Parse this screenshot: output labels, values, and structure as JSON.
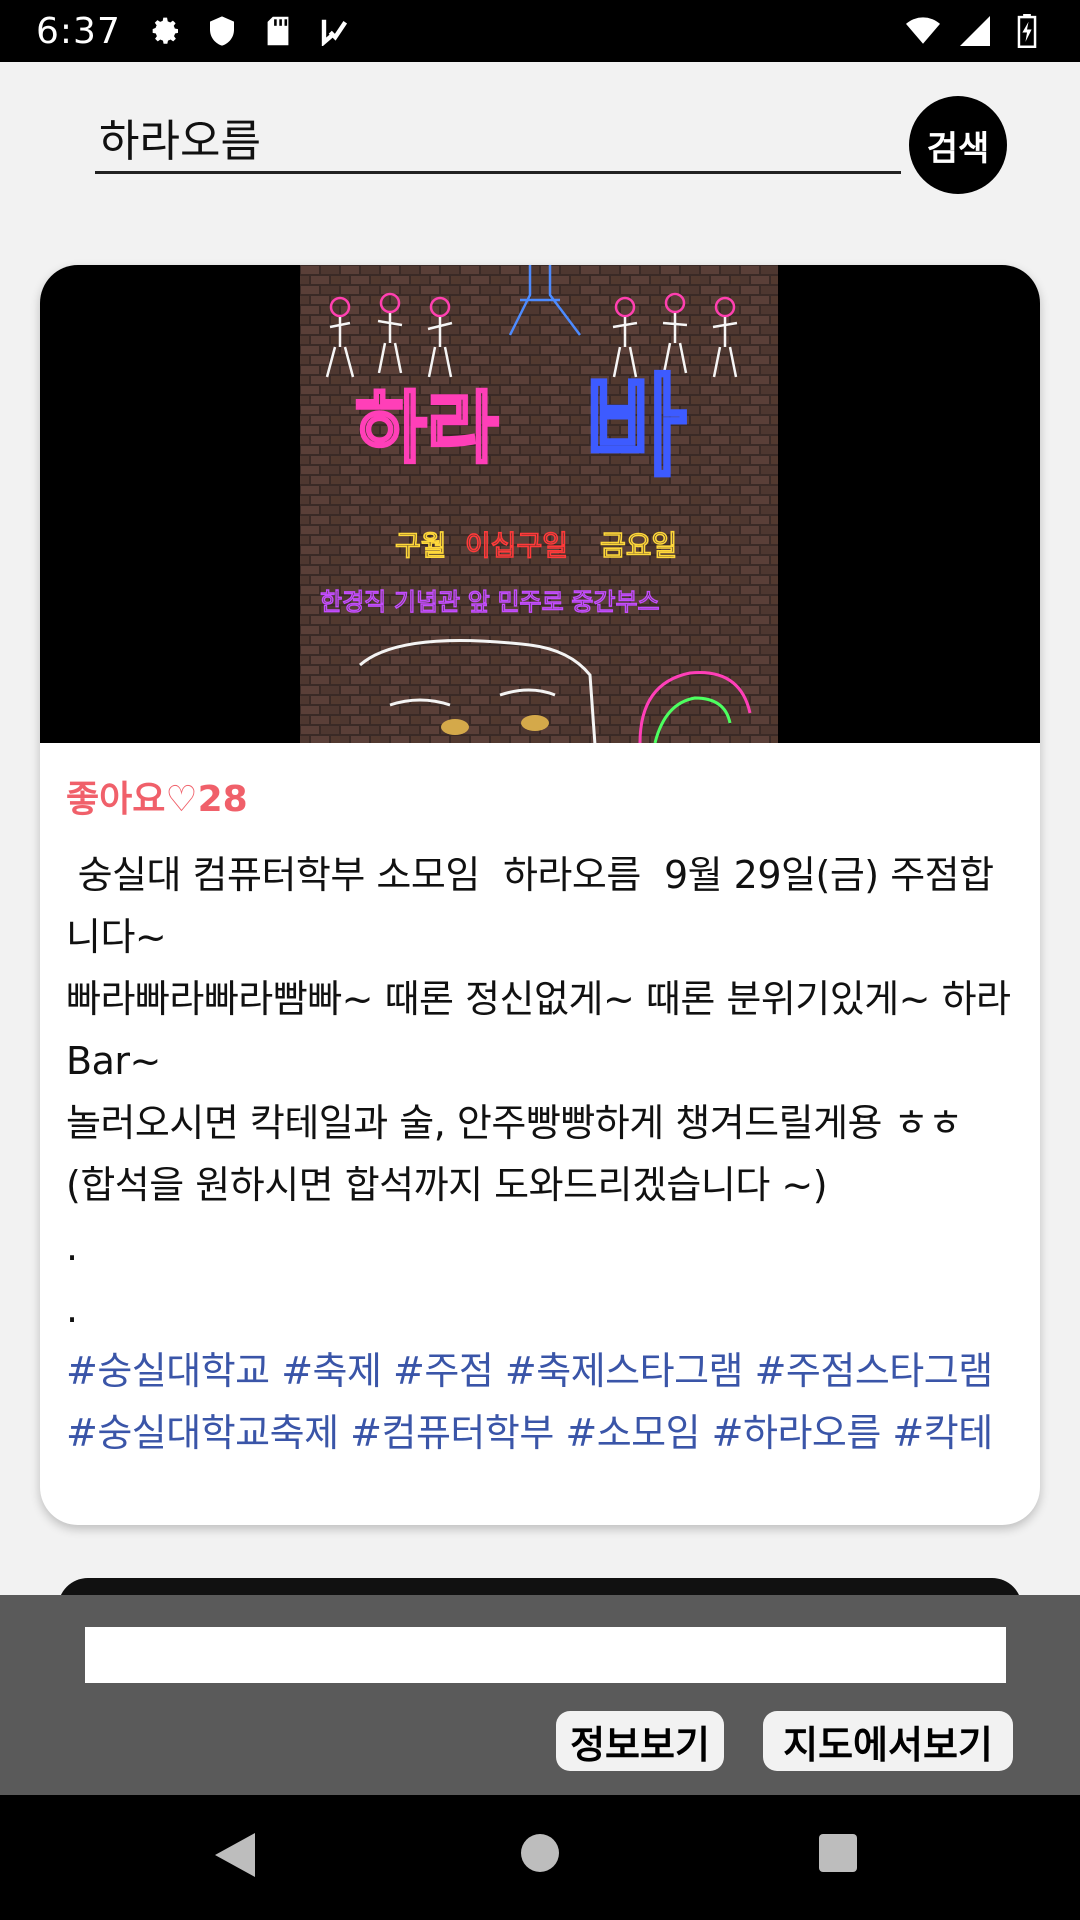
{
  "status_bar": {
    "time": "6:37",
    "icons_left": [
      "gear-icon",
      "shield-icon",
      "sd-card-icon",
      "check-icon"
    ],
    "icons_right": [
      "wifi-icon",
      "signal-icon",
      "battery-icon"
    ]
  },
  "search": {
    "value": "하라오름",
    "button_label": "검색"
  },
  "post": {
    "likes": "좋아요♡28",
    "text": " 숭실대 컴퓨터학부 소모임  하라오름  9월 29일(금) 주점합니다~\n빠라빠라빠라빰빠~ 때론 정신없게~ 때론 분위기있게~ 하라 Bar~\n놀러오시면 칵테일과 술, 안주빵빵하게 챙겨드릴게용 ㅎㅎ (합석을 원하시면 합석까지 도와드리겠습니다 ~)\n.\n.",
    "hashtags": "#숭실대학교 #축제 #주점 #축제스타그램 #주점스타그램 #숭실대학교축제 #컴퓨터학부 #소모임 #하라오름 #칵테",
    "image_text": {
      "title_left": "하라",
      "title_right": "바",
      "line1_a": "구월",
      "line1_b": "이십구일",
      "line1_c": "금요일",
      "line2": "한경직 기념관 앞 민주로 중간부스"
    }
  },
  "bottom_panel": {
    "input_value": "",
    "info_button": "정보보기",
    "map_button": "지도에서보기"
  },
  "colors": {
    "likes": "#f0606a",
    "hashtags": "#3a55a8",
    "panel": "#5a5a5a"
  }
}
